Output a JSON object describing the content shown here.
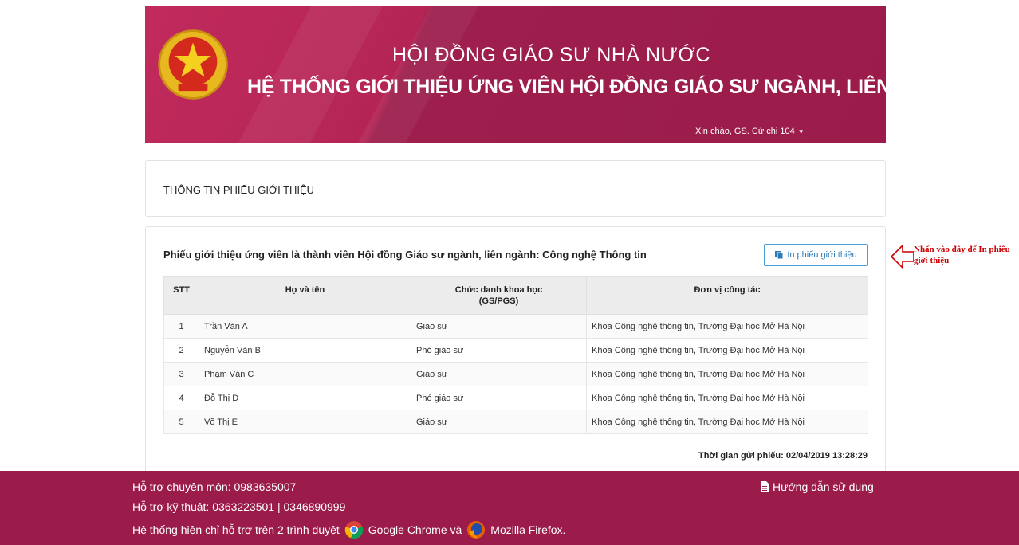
{
  "header": {
    "title_line1": "HỘI ĐỒNG GIÁO SƯ NHÀ NƯỚC",
    "title_line2": "HỆ THỐNG GIỚI THIỆU ỨNG VIÊN HỘI ĐỒNG GIÁO SƯ NGÀNH, LIÊN NGÀNH",
    "greeting": "Xin chào, GS. Cử chi 104",
    "emblem_icon": "national-emblem-icon"
  },
  "info_panel": {
    "title": "THÔNG TIN PHIẾU GIỚI THIỆU"
  },
  "main_panel": {
    "heading": "Phiếu giới thiệu ứng viên là thành viên Hội đồng Giáo sư ngành, liên ngành: Công nghệ Thông tin",
    "print_button": "In phiếu giới thiệu",
    "columns": [
      "STT",
      "Họ và tên",
      "Chức danh khoa học (GS/PGS)",
      "Đơn vị công tác"
    ],
    "rows": [
      {
        "stt": "1",
        "name": "Trần Văn A",
        "title": "Giáo sư",
        "unit": "Khoa Công nghệ thông tin, Trường Đại học Mở Hà Nội"
      },
      {
        "stt": "2",
        "name": "Nguyễn Văn B",
        "title": "Phó giáo sư",
        "unit": "Khoa Công nghệ thông tin, Trường Đại học Mở Hà Nội"
      },
      {
        "stt": "3",
        "name": "Phạm Văn C",
        "title": "Giáo sư",
        "unit": "Khoa Công nghệ thông tin, Trường Đại học Mở Hà Nội"
      },
      {
        "stt": "4",
        "name": "Đỗ Thị D",
        "title": "Phó giáo sư",
        "unit": "Khoa Công nghệ thông tin, Trường Đại học Mở Hà Nội"
      },
      {
        "stt": "5",
        "name": "Võ Thị E",
        "title": "Giáo sư",
        "unit": "Khoa Công nghệ thông tin, Trường Đại học Mở Hà Nội"
      }
    ],
    "submit_time": "Thời gian gửi phiếu: 02/04/2019 13:28:29"
  },
  "annotation": {
    "text": "Nhấn vào đây để In phiếu giới thiệu"
  },
  "footer": {
    "support_expert": "Hỗ trợ chuyên môn: 0983635007",
    "support_tech": "Hỗ trợ kỹ thuật: 0363223501 | 0346890999",
    "browser_note_prefix": "Hệ thống hiện chỉ hỗ trợ trên 2 trình duyệt",
    "chrome": "Google Chrome và",
    "firefox": "Mozilla Firefox.",
    "guide": "Hướng dẫn sử dụng"
  },
  "colors": {
    "brand": "#9b1c4b",
    "button_border": "#4a9ed6",
    "annotation": "#cc0000"
  }
}
